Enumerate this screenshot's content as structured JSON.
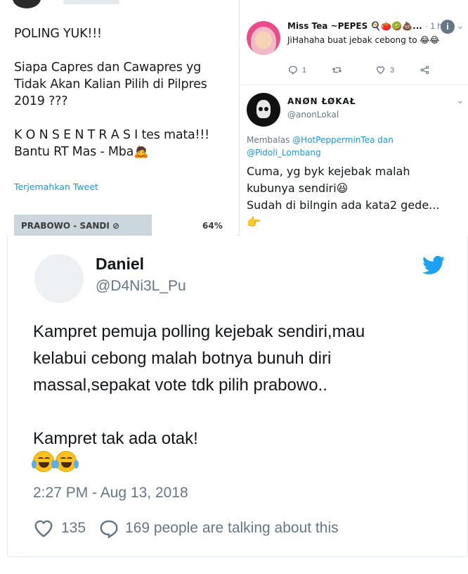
{
  "left_tweet": {
    "poll_text_lines": [
      "POLING YUK!!!",
      "",
      "Siapa Capres dan Cawapres yg",
      "Tidak Akan Kalian Pilih di Pilpres",
      "2019 ???",
      "",
      "K O N S E N T R A S I tes mata!!!",
      "Bantu RT Mas - Mba🙇"
    ],
    "translate_link": "Terjemahkan Tweet",
    "poll_option": "PRABOWO - SANDI ⊘",
    "poll_percent": "64%",
    "poll_fraction": 0.64
  },
  "right_thread": {
    "reply1": {
      "name": "Miss Tea ~PEPES 🍳🍅🥝💩...",
      "time": "· 1 h",
      "text": "JiHahaha buat jebak cebong to 😂😂",
      "replies": "1",
      "likes": "3"
    },
    "reply2": {
      "name": "ANØN ŁØKAŁ",
      "handle": "@anonLokal",
      "reply_prefix": "Membalas",
      "mention1": "@HotPepperminTea",
      "reply_and": "dan",
      "mention2": "@Pidoli_Lombang",
      "body_lines": [
        "Cuma, yg byk kejebak malah",
        "kubunya sendiri😆",
        "Sudah di bilngin ada kata2 gede...",
        "👉"
      ]
    }
  },
  "tweet": {
    "name": "Daniel",
    "handle": "@D4Ni3L_Pu",
    "text_lines": [
      "Kampret pemuja polling kejebak sendiri,mau",
      "kelabui cebong malah botnya bunuh diri",
      "massal,sepakat vote tdk pilih prabowo..",
      "",
      "Kampret tak ada otak!"
    ],
    "emojis": [
      "tears-of-joy",
      "tears-of-joy"
    ],
    "timestamp": "2:27 PM - Aug 13, 2018",
    "likes": "135",
    "talking": "169 people are talking about this",
    "accent": "#1da1f2"
  }
}
